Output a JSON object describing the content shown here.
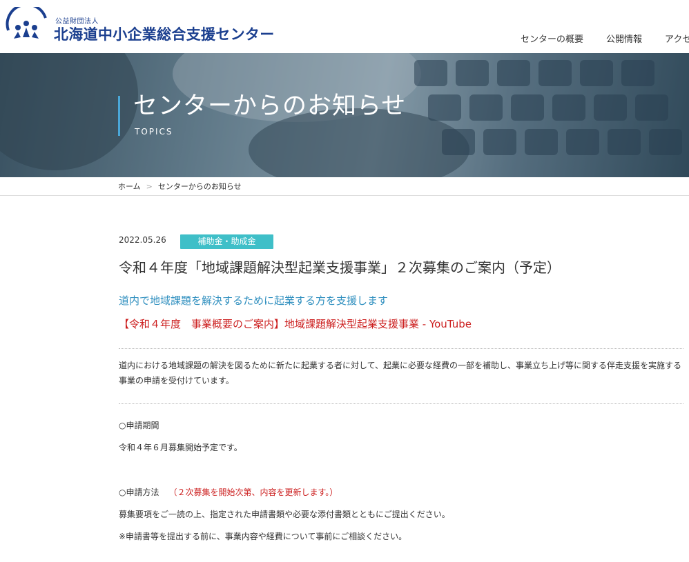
{
  "header": {
    "org_type": "公益財団法人",
    "org_name": "北海道中小企業総合支援センター",
    "logo_icon": "center-logo-icon",
    "brand_color": "#1b3f8f",
    "nav": [
      {
        "label": "センターの概要"
      },
      {
        "label": "公開情報"
      },
      {
        "label": "アクセ"
      }
    ]
  },
  "hero": {
    "title": "センターからのお知らせ",
    "subtitle": "TOPICS"
  },
  "breadcrumb": {
    "home": "ホーム",
    "separator": ">",
    "current": "センターからのお知らせ"
  },
  "article": {
    "date": "2022.05.26",
    "category": "補助金・助成金",
    "title": "令和４年度「地域課題解決型起業支援事業」２次募集のご案内（予定）",
    "lead": "道内で地域課題を解決するために起業する方を支援します",
    "video_link": "【令和４年度　事業概要のご案内】地域課題解決型起業支援事業 - YouTube",
    "body": "道内における地域課題の解決を図るために新たに起業する者に対して、起業に必要な経費の一部を補助し、事業立ち上げ等に関する伴走支援を実施する事業の申請を受付けています。",
    "period_label": "○申請期間",
    "period_value": "令和４年６月募集開始予定です。",
    "method_label": "○申請方法",
    "method_note": "（２次募集を開始次第、内容を更新します。）",
    "method_value": "募集要項をご一読の上、指定された申請書類や必要な添付書類とともにご提出ください。",
    "method_caution": "※申請書等を提出する前に、事業内容や経費について事前にご相談ください。"
  },
  "colors": {
    "accent_teal": "#3fbfc8",
    "lead_blue": "#2f8fbf",
    "link_red": "#cc1f1f"
  }
}
